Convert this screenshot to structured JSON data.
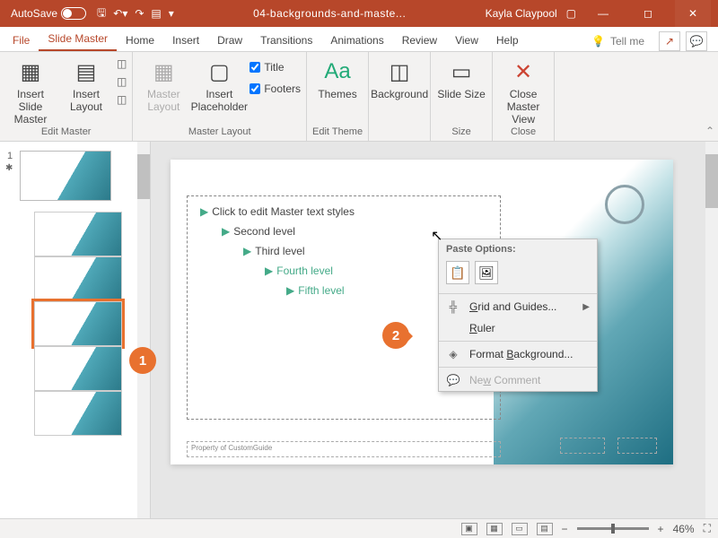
{
  "titlebar": {
    "autosave": "AutoSave",
    "filename": "04-backgrounds-and-maste...",
    "user": "Kayla Claypool"
  },
  "tabs": {
    "file": "File",
    "slidemaster": "Slide Master",
    "home": "Home",
    "insert": "Insert",
    "draw": "Draw",
    "transitions": "Transitions",
    "animations": "Animations",
    "review": "Review",
    "view": "View",
    "help": "Help",
    "tellme": "Tell me"
  },
  "ribbon": {
    "insert_slide_master": "Insert Slide Master",
    "insert_layout": "Insert Layout",
    "master_layout": "Master Layout",
    "insert_placeholder": "Insert Placeholder",
    "title_chk": "Title",
    "footers_chk": "Footers",
    "themes": "Themes",
    "background": "Background",
    "slide_size": "Slide Size",
    "close_master": "Close Master View",
    "g_edit_master": "Edit Master",
    "g_master_layout": "Master Layout",
    "g_edit_theme": "Edit Theme",
    "g_size": "Size",
    "g_close": "Close"
  },
  "slide": {
    "l1": "Click to edit Master text styles",
    "l2": "Second level",
    "l3": "Third level",
    "l4": "Fourth level",
    "l5": "Fifth level",
    "footer": "Property of CustomGuide"
  },
  "ctx": {
    "paste_head": "Paste Options:",
    "grid": "Grid and Guides...",
    "ruler": "Ruler",
    "format_bg": "Format Background...",
    "new_comment": "New Comment"
  },
  "status": {
    "views": [
      "Normal",
      "Slide Sorter",
      "Reading",
      "Slide Show"
    ],
    "zoom": "46%"
  },
  "callouts": {
    "c1": "1",
    "c2": "2"
  },
  "thumbs": {
    "num": "1"
  }
}
